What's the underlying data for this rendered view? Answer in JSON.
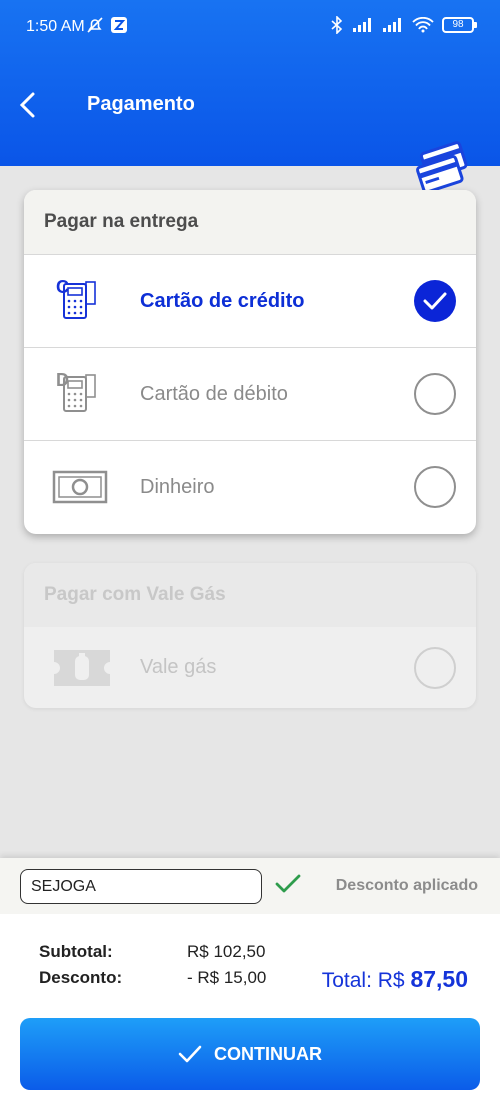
{
  "status_bar": {
    "time": "1:50 AM",
    "battery": "98"
  },
  "header": {
    "title": "Pagamento",
    "back_icon": "chevron-left-icon",
    "decor_icon": "credit-cards-icon"
  },
  "pay_on_delivery": {
    "title": "Pagar na entrega",
    "options": [
      {
        "label": "Cartão de crédito",
        "icon": "credit-card-machine-icon",
        "selected": true
      },
      {
        "label": "Cartão de débito",
        "icon": "debit-card-machine-icon",
        "selected": false
      },
      {
        "label": "Dinheiro",
        "icon": "cash-icon",
        "selected": false
      }
    ]
  },
  "gas_voucher": {
    "title": "Pagar com Vale Gás",
    "options": [
      {
        "label": "Vale gás",
        "icon": "gas-voucher-icon",
        "selected": false
      }
    ]
  },
  "coupon": {
    "value": "SEJOGA",
    "status": "Desconto aplicado"
  },
  "summary": {
    "subtotal_label": "Subtotal:",
    "subtotal_value": "R$ 102,50",
    "discount_label": "Desconto:",
    "discount_value": "- R$ 15,00",
    "total_label": "Total: R$",
    "total_value": "87,50"
  },
  "continue_button": {
    "label": "CONTINUAR"
  },
  "colors": {
    "primary": "#0b5ce9",
    "selected": "#0d2fd6",
    "success": "#2e9c4c"
  }
}
